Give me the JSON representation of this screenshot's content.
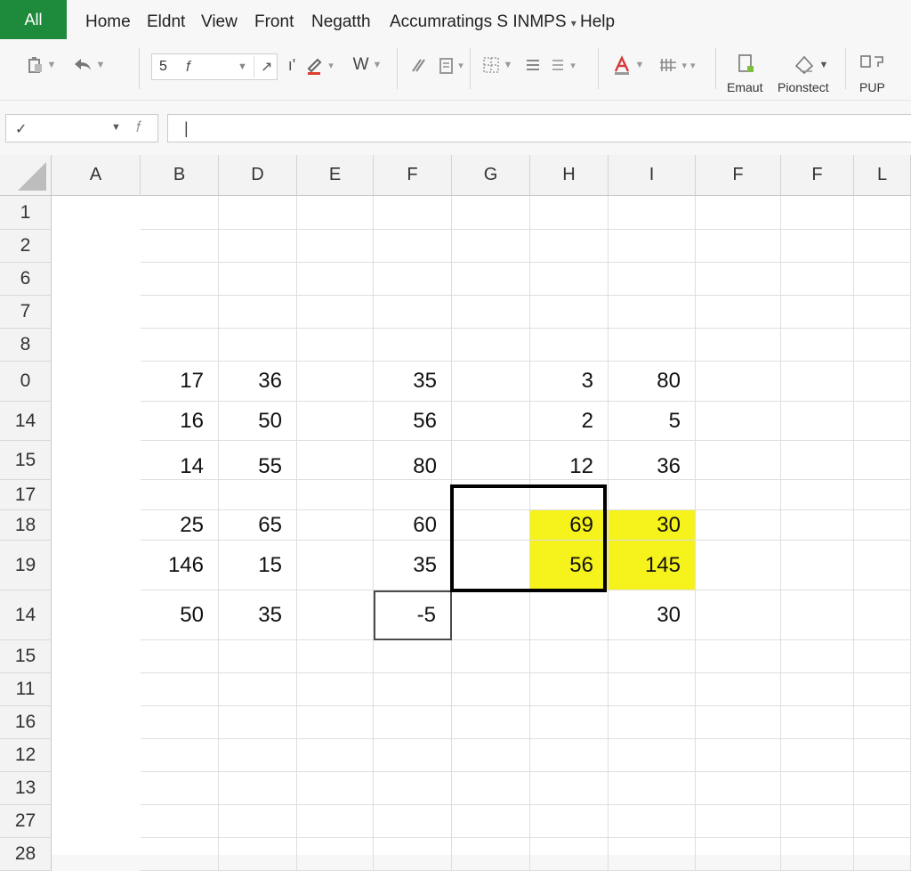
{
  "menubar": {
    "file_tab": "All",
    "items": [
      "Home",
      "Eldnt",
      "View",
      "Front",
      "Negatth",
      "Accumratings S INMPS",
      "Help"
    ],
    "dropdown_caret": "▾"
  },
  "ribbon": {
    "font_size": "5",
    "font_name": "f",
    "bold_label": "W",
    "groups": [
      {
        "label": "Emaut",
        "icon": "conditional-format-icon"
      },
      {
        "label": "Pionstect",
        "icon": "protect-icon"
      },
      {
        "label": "PUP",
        "icon": "publish-icon"
      }
    ],
    "font_color": "#e03c31"
  },
  "formula_bar": {
    "name_box": "✓",
    "formula_value": "|"
  },
  "grid": {
    "columns": [
      "A",
      "B",
      "D",
      "E",
      "F",
      "G",
      "H",
      "I",
      "F",
      "F",
      "L"
    ],
    "rows": [
      {
        "label": "1",
        "cells": [
          "",
          "",
          "",
          "",
          "",
          "",
          "",
          "",
          "",
          "",
          ""
        ]
      },
      {
        "label": "2",
        "cells": [
          "",
          "",
          "",
          "",
          "",
          "",
          "",
          "",
          "",
          "",
          ""
        ]
      },
      {
        "label": "6",
        "cells": [
          "",
          "",
          "",
          "",
          "",
          "",
          "",
          "",
          "",
          "",
          ""
        ]
      },
      {
        "label": "7",
        "cells": [
          "",
          "",
          "",
          "",
          "",
          "",
          "",
          "",
          "",
          "",
          ""
        ]
      },
      {
        "label": "8",
        "cells": [
          "",
          "",
          "",
          "",
          "",
          "",
          "",
          "",
          "",
          "",
          ""
        ]
      },
      {
        "label": "0",
        "cells": [
          "17",
          "36",
          "",
          "35",
          "",
          "3",
          "80",
          "",
          "",
          "",
          ""
        ]
      },
      {
        "label": "14",
        "cells": [
          "16",
          "50",
          "",
          "56",
          "",
          "2",
          "5",
          "",
          "",
          "",
          ""
        ]
      },
      {
        "label": "15",
        "cells": [
          "14",
          "55",
          "",
          "80",
          "",
          "12",
          "36",
          "",
          "",
          "",
          ""
        ]
      },
      {
        "label": "17",
        "cells": [
          "",
          "",
          "",
          "",
          "",
          "",
          "",
          "",
          "",
          "",
          ""
        ]
      },
      {
        "label": "18",
        "cells": [
          "25",
          "65",
          "",
          "60",
          "",
          "69",
          "30",
          "",
          "",
          "",
          ""
        ]
      },
      {
        "label": "19",
        "cells": [
          "146",
          "15",
          "",
          "35",
          "",
          "56",
          "145",
          "",
          "",
          "",
          ""
        ]
      },
      {
        "label": "14",
        "cells": [
          "50",
          "35",
          "",
          "-5",
          "",
          "",
          "30",
          "",
          "",
          "",
          ""
        ]
      },
      {
        "label": "15",
        "cells": [
          "",
          "",
          "",
          "",
          "",
          "",
          "",
          "",
          "",
          "",
          ""
        ]
      },
      {
        "label": "11",
        "cells": [
          "",
          "",
          "",
          "",
          "",
          "",
          "",
          "",
          "",
          "",
          ""
        ]
      },
      {
        "label": "16",
        "cells": [
          "",
          "",
          "",
          "",
          "",
          "",
          "",
          "",
          "",
          "",
          ""
        ]
      },
      {
        "label": "12",
        "cells": [
          "",
          "",
          "",
          "",
          "",
          "",
          "",
          "",
          "",
          "",
          ""
        ]
      },
      {
        "label": "13",
        "cells": [
          "",
          "",
          "",
          "",
          "",
          "",
          "",
          "",
          "",
          "",
          ""
        ]
      },
      {
        "label": "27",
        "cells": [
          "",
          "",
          "",
          "",
          "",
          "",
          "",
          "",
          "",
          "",
          ""
        ]
      },
      {
        "label": "28",
        "cells": [
          "",
          "",
          "",
          "",
          "",
          "",
          "",
          "",
          "",
          "",
          ""
        ]
      }
    ],
    "highlight_color": "#f6f21c"
  }
}
